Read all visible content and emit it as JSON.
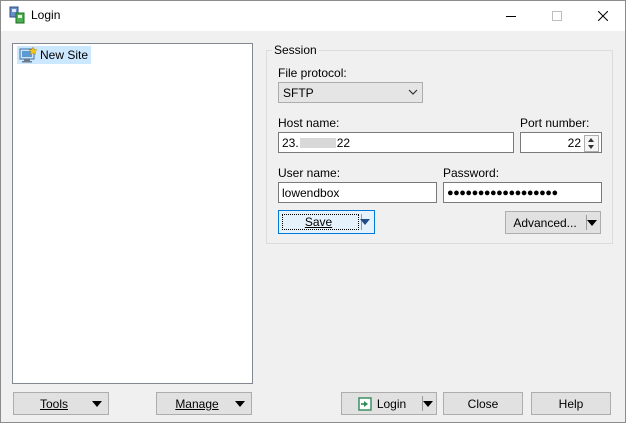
{
  "window": {
    "title": "Login",
    "minimize_icon": "minimize-icon",
    "maximize_icon": "maximize-icon",
    "close_icon": "close-icon"
  },
  "tree": {
    "items": [
      {
        "label": "New Site",
        "icon": "new-site-computer-icon"
      }
    ]
  },
  "left_buttons": {
    "tools": "Tools",
    "manage": "Manage"
  },
  "session": {
    "caption": "Session",
    "file_protocol_label": "File protocol:",
    "file_protocol_value": "SFTP",
    "host_name_label": "Host name:",
    "host_name_prefix": "23.",
    "host_name_suffix": "22",
    "port_label": "Port number:",
    "port_value": "22",
    "user_name_label": "User name:",
    "user_name_value": "lowendbox",
    "password_label": "Password:",
    "password_value": "●●●●●●●●●●●●●●●●●●",
    "save_label": "Save",
    "advanced_label": "Advanced..."
  },
  "bottom_buttons": {
    "login": "Login",
    "close": "Close",
    "help": "Help"
  },
  "colors": {
    "accent": "#0078d7",
    "selection": "#cce8ff",
    "button_face": "#e1e1e1"
  }
}
